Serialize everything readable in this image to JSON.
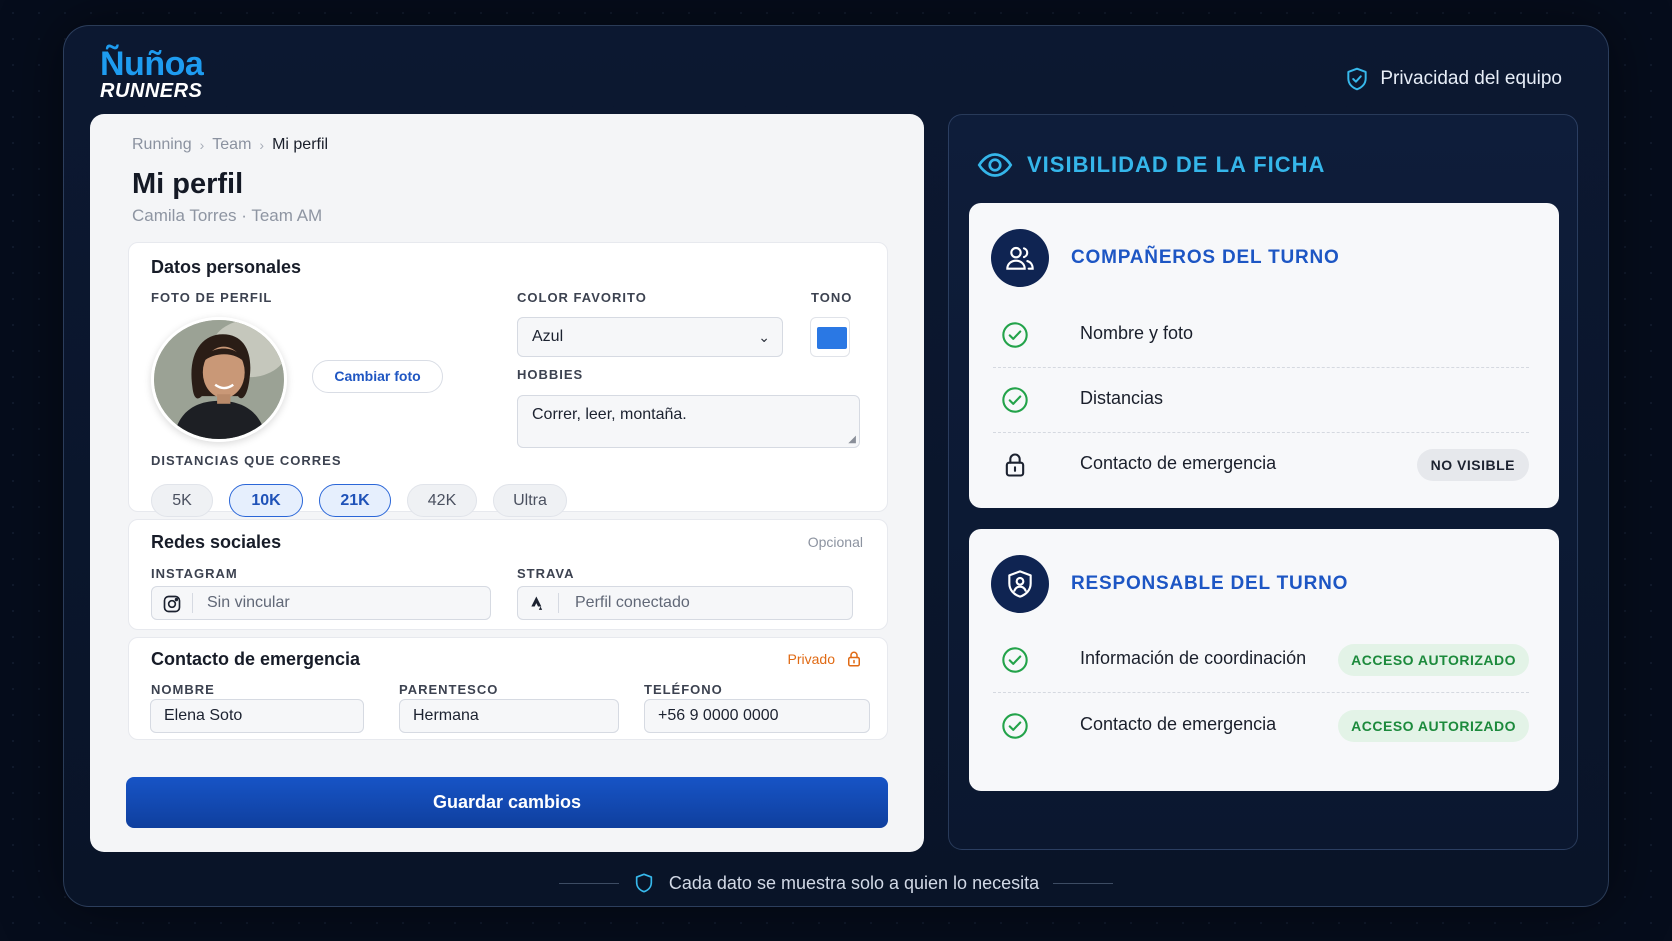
{
  "brand": {
    "line1": "Ñuñoa",
    "line2": "RUNNERS"
  },
  "header": {
    "privacy_label": "Privacidad del equipo"
  },
  "breadcrumb": [
    "Running",
    "Team",
    "Mi perfil"
  ],
  "profile": {
    "title": "Mi perfil",
    "subtitle": "Camila Torres · Team AM"
  },
  "personal": {
    "title": "Datos personales",
    "photo_label": "FOTO DE PERFIL",
    "change_photo": "Cambiar foto",
    "color_label": "COLOR FAVORITO",
    "color_value": "Azul",
    "tone_label": "TONO",
    "tone_color": "#2a78e4",
    "hobbies_label": "HOBBIES",
    "hobbies_value": "Correr, leer, montaña.",
    "distances_label": "DISTANCIAS QUE CORRES",
    "distances": [
      {
        "label": "5K",
        "selected": false
      },
      {
        "label": "10K",
        "selected": true
      },
      {
        "label": "21K",
        "selected": true
      },
      {
        "label": "42K",
        "selected": false
      },
      {
        "label": "Ultra",
        "selected": false
      }
    ]
  },
  "social": {
    "title": "Redes sociales",
    "optional": "Opcional",
    "instagram_label": "INSTAGRAM",
    "instagram_value": "Sin vincular",
    "strava_label": "STRAVA",
    "strava_value": "Perfil conectado"
  },
  "emergency": {
    "title": "Contacto de emergencia",
    "private": "Privado",
    "name_label": "NOMBRE",
    "name_value": "Elena Soto",
    "relation_label": "PARENTESCO",
    "relation_value": "Hermana",
    "phone_label": "TELÉFONO",
    "phone_value": "+56 9 0000 0000"
  },
  "save_button": "Guardar cambios",
  "visibility": {
    "title": "VISIBILIDAD DE LA FICHA",
    "teammates": {
      "title": "COMPAÑEROS DEL TURNO",
      "rows": [
        {
          "label": "Nombre y foto",
          "icon": "check-icon"
        },
        {
          "label": "Distancias",
          "icon": "check-icon"
        },
        {
          "label": "Contacto de emergencia",
          "icon": "lock-icon",
          "badge": "NO VISIBLE"
        }
      ]
    },
    "leader": {
      "title": "RESPONSABLE DEL TURNO",
      "rows": [
        {
          "label": "Información de coordinación",
          "icon": "check-icon",
          "badge": "ACCESO AUTORIZADO"
        },
        {
          "label": "Contacto de emergencia",
          "icon": "check-icon",
          "badge": "ACCESO AUTORIZADO"
        }
      ]
    }
  },
  "footer": "Cada dato se muestra solo a quien lo necesita"
}
